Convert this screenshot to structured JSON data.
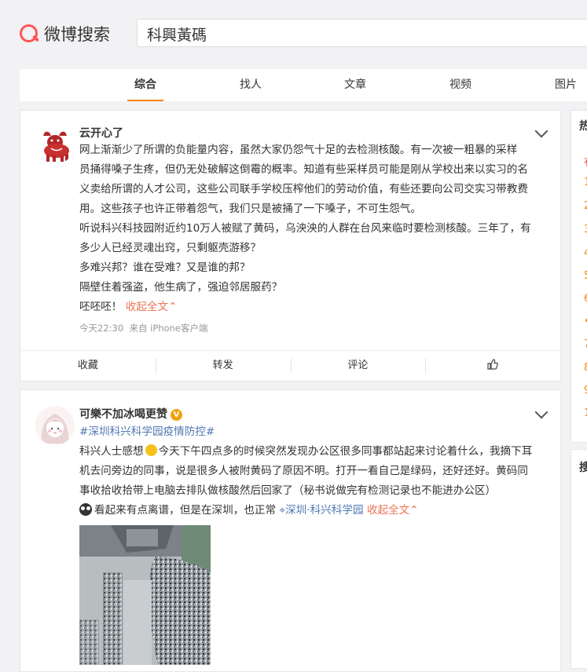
{
  "header": {
    "logo_text": "微博搜索",
    "search_value": "科興黃碼"
  },
  "tabs": [
    "综合",
    "找人",
    "文章",
    "视频",
    "图片"
  ],
  "post1": {
    "user": "云开心了",
    "lines": [
      "网上渐渐少了所谓的负能量内容，虽然大家仍怨气十足的去检测核酸。有一次被一粗暴的采样",
      "员捅得嗓子生疼，但仍无处破解这倒霉的概率。知道有些采样员可能是刚从学校出来以实习的名",
      "义卖给所谓的人才公司，这些公司联手学校压榨他们的劳动价值，有些还要向公司交实习带教费",
      "用。这些孩子也许正带着怨气，我们只是被捅了一下嗓子，不可生怨气。",
      "听说科兴科技园附近约10万人被赋了黄码，乌泱泱的人群在台风来临时要检测核酸。三年了，有",
      "多少人已经灵魂出窍，只剩躯壳游移？",
      "多难兴邦？谁在受难？又是谁的邦？",
      "隔壁住着强盗，他生病了，强迫邻居服药？"
    ],
    "last_line": "呸呸呸！",
    "collapse": "收起全文",
    "time": "今天22:30",
    "source": "来自 iPhone客户端",
    "actions": [
      "收藏",
      "转发",
      "评论"
    ]
  },
  "post2": {
    "user": "可樂不加冰喝更赞",
    "verified_icon": "V",
    "topic": "#深圳科兴科学园疫情防控#",
    "line1_a": "科兴人士感想",
    "line1_b": "今天下午四点多的时候突然发现办公区很多同事都站起来讨论着什么，我摘下耳",
    "line2": "机去问旁边的同事，说是很多人被附黄码了原因不明。打开一看自己是绿码，还好还好。黄码同",
    "line3": "事收拾收拾带上电脑去排队做核酸然后回家了（秘书说做完有检测记录也不能进办公区）",
    "line4": "看起来有点离谱，但是在深圳，也正常",
    "location": "深圳·科兴科学园",
    "collapse": "收起全文"
  },
  "sidebar": {
    "hot_title": "热",
    "ranks": [
      "有",
      "1",
      "2",
      "3",
      "4",
      "5",
      "6",
      "•",
      "7",
      "8",
      "9",
      "1"
    ],
    "search_title": "搜"
  }
}
